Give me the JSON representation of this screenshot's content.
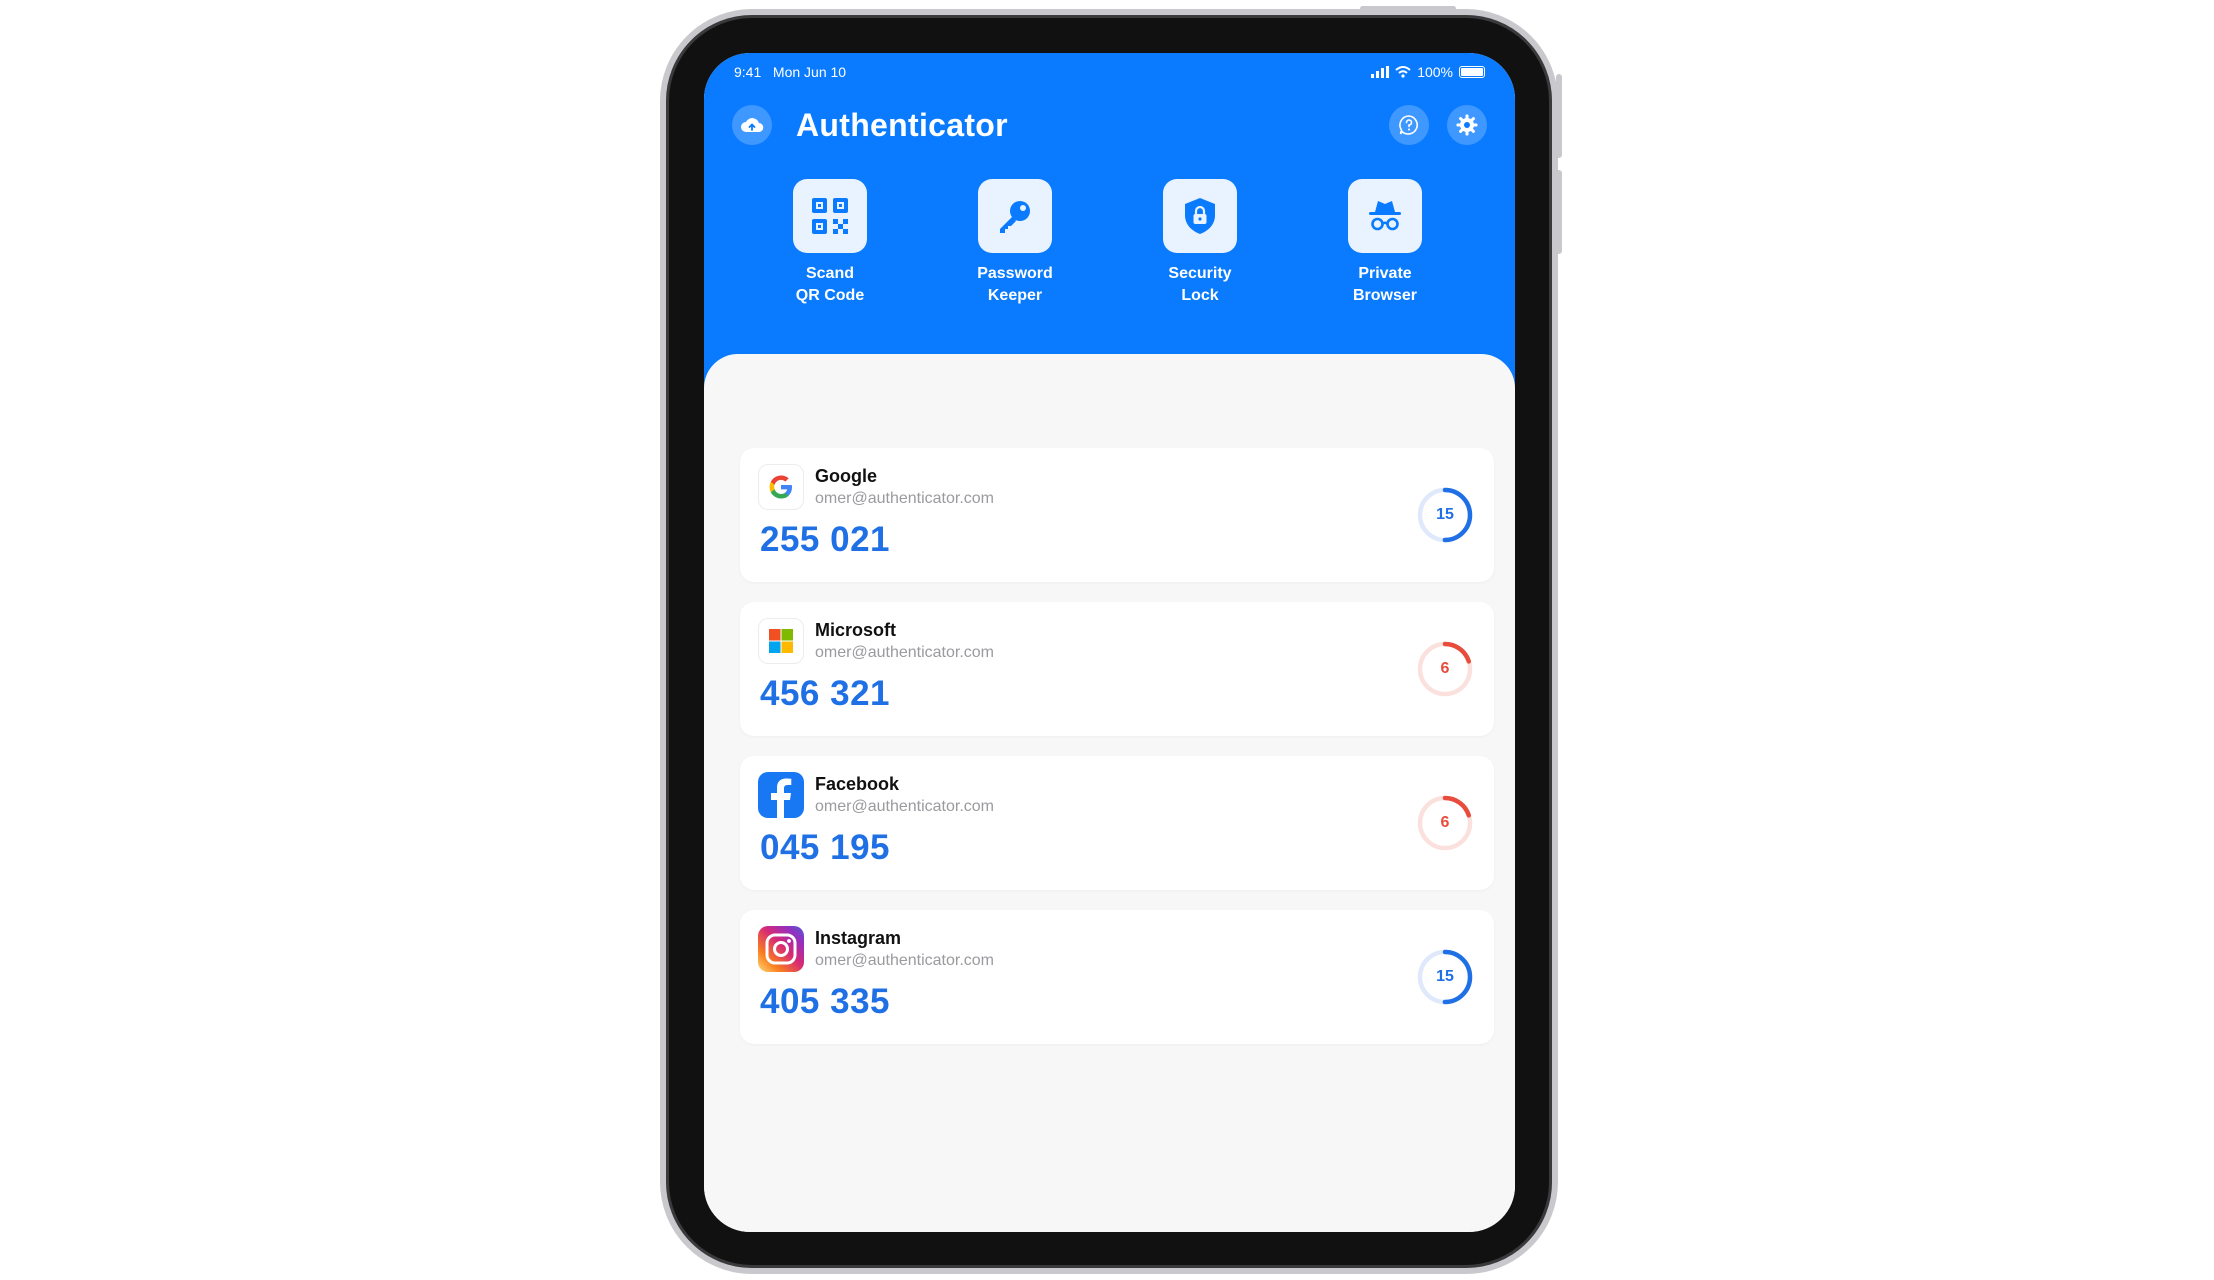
{
  "status_bar": {
    "time": "9:41",
    "date": "Mon Jun 10",
    "battery": "100%"
  },
  "header": {
    "title": "Authenticator"
  },
  "features": [
    {
      "line1": "Scand",
      "line2": "QR Code",
      "icon": "qr-code-icon"
    },
    {
      "line1": "Password",
      "line2": "Keeper",
      "icon": "key-icon"
    },
    {
      "line1": "Security",
      "line2": "Lock",
      "icon": "shield-lock-icon"
    },
    {
      "line1": "Private",
      "line2": "Browser",
      "icon": "incognito-icon"
    }
  ],
  "accounts": [
    {
      "name": "Google",
      "email": "omer@authenticator.com",
      "code": "255 021",
      "seconds": "15",
      "progress": 0.5,
      "status": "ok"
    },
    {
      "name": "Microsoft",
      "email": "omer@authenticator.com",
      "code": "456 321",
      "seconds": "6",
      "progress": 0.2,
      "status": "warn"
    },
    {
      "name": "Facebook",
      "email": "omer@authenticator.com",
      "code": "045 195",
      "seconds": "6",
      "progress": 0.2,
      "status": "warn"
    },
    {
      "name": "Instagram",
      "email": "omer@authenticator.com",
      "code": "405 335",
      "seconds": "15",
      "progress": 0.5,
      "status": "ok"
    }
  ],
  "colors": {
    "primary": "#0a7bff",
    "code": "#1f6fe5",
    "ok_ring": "#1f6fe5",
    "warn_ring": "#e74c3c",
    "warn_track": "#fbe1de",
    "ok_track": "#dfe9fb"
  }
}
